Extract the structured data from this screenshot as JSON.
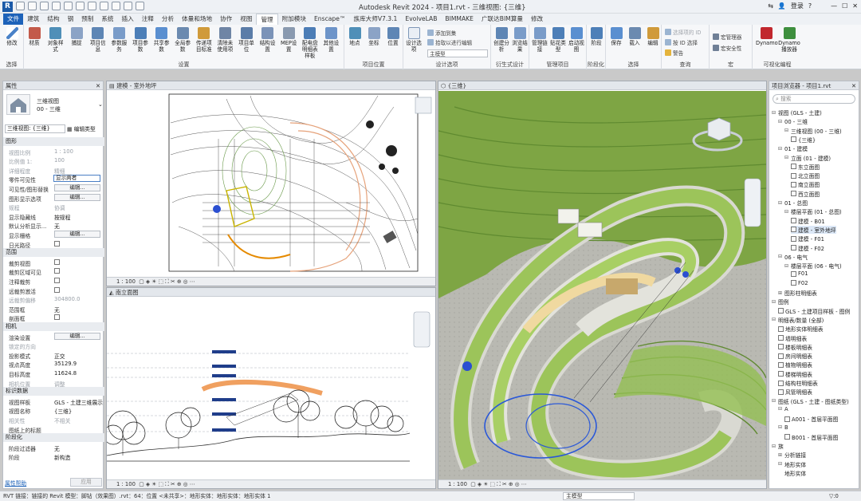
{
  "window": {
    "title": "Autodesk Revit 2024 - 项目1.rvt - 三维视图: {三维}",
    "user": "登录",
    "logo": "R"
  },
  "menu_tabs": [
    {
      "label": "文件",
      "type": "file"
    },
    {
      "label": "建筑"
    },
    {
      "label": "结构"
    },
    {
      "label": "钢"
    },
    {
      "label": "预制"
    },
    {
      "label": "系统"
    },
    {
      "label": "插入"
    },
    {
      "label": "注释"
    },
    {
      "label": "分析"
    },
    {
      "label": "体量和场地"
    },
    {
      "label": "协作"
    },
    {
      "label": "视图"
    },
    {
      "label": "管理",
      "type": "active"
    },
    {
      "label": "附加模块"
    },
    {
      "label": "Enscape™"
    },
    {
      "label": "族库大师V7.3.1"
    },
    {
      "label": "EvolveLAB"
    },
    {
      "label": "BIMMAKE"
    },
    {
      "label": "广联达BIM算量"
    },
    {
      "label": "修改"
    }
  ],
  "ribbon": {
    "groups": [
      {
        "label": "选择",
        "buttons": [
          {
            "label": "修改",
            "icon": "cursor-icon"
          }
        ]
      },
      {
        "label": "设置",
        "buttons": [
          {
            "label": "材质",
            "icon": "material-sphere-icon"
          },
          {
            "label": "对象样式",
            "icon": "object-styles-icon"
          },
          {
            "label": "捕捉",
            "icon": "snap-magnet-icon"
          },
          {
            "label": "项目信息",
            "icon": "project-info-icon"
          },
          {
            "label": "参数服务",
            "icon": "param-service-icon"
          },
          {
            "label": "项目参数",
            "icon": "project-param-icon"
          },
          {
            "label": "共享参数",
            "icon": "shared-param-icon"
          },
          {
            "label": "全局参数",
            "icon": "global-param-icon"
          },
          {
            "label": "传递项目标准",
            "icon": "transfer-standards-icon"
          },
          {
            "label": "清除未使用项",
            "icon": "purge-icon"
          },
          {
            "label": "项目单位",
            "icon": "units-icon"
          },
          {
            "label": "结构设置",
            "icon": "structural-settings-icon"
          },
          {
            "label": "MEP设置",
            "icon": "mep-settings-icon"
          },
          {
            "label": "配电盘明细表样板",
            "icon": "panel-schedule-icon"
          },
          {
            "label": "其他设置",
            "icon": "wrench-icon"
          }
        ]
      },
      {
        "label": "项目位置",
        "buttons": [
          {
            "label": "地点",
            "icon": "globe-icon"
          },
          {
            "label": "坐标",
            "icon": "coordinates-icon"
          },
          {
            "label": "位置",
            "icon": "location-icon"
          }
        ]
      },
      {
        "label": "设计选项",
        "buttons": [
          {
            "label": "设计选项",
            "icon": "design-options-icon"
          }
        ],
        "small": [
          "添加到集",
          "拾取以进行编辑"
        ],
        "select_value": "主模型"
      },
      {
        "label": "衍生式设计",
        "buttons": [
          {
            "label": "创建分析",
            "icon": "create-study-icon"
          },
          {
            "label": "浏览结果",
            "icon": "explore-outcomes-icon"
          }
        ]
      },
      {
        "label": "管理项目",
        "buttons": [
          {
            "label": "管理链接",
            "icon": "manage-links-icon"
          },
          {
            "label": "贴花类型",
            "icon": "decal-icon"
          },
          {
            "label": "启动视图",
            "icon": "startup-view-icon"
          }
        ]
      },
      {
        "label": "阶段化",
        "buttons": [
          {
            "label": "阶段",
            "icon": "phases-icon"
          }
        ]
      },
      {
        "label": "选择",
        "buttons": [
          {
            "label": "保存",
            "icon": "save-selection-icon"
          },
          {
            "label": "载入",
            "icon": "load-selection-icon"
          },
          {
            "label": "编辑",
            "icon": "edit-selection-icon"
          }
        ]
      },
      {
        "label": "查询",
        "small": [
          "选择项的 ID",
          "按 ID 选择",
          "警告"
        ]
      },
      {
        "label": "宏",
        "small": [
          "宏管理器",
          "宏安全性"
        ]
      },
      {
        "label": "可视化编程",
        "buttons": [
          {
            "label": "Dynamo",
            "icon": "dynamo-icon"
          },
          {
            "label": "Dynamo播放器",
            "icon": "dynamo-player-icon"
          }
        ]
      }
    ]
  },
  "properties": {
    "title": "属性",
    "type_name": "三维视图",
    "type_sub": "00 - 三维",
    "selector": "三维视图: {三维}",
    "edit_type": "编辑类型",
    "help": "属性帮助",
    "apply": "应用",
    "rows": [
      {
        "kind": "sec",
        "label": "图形"
      },
      {
        "k": "视图比例",
        "v": "1 : 100",
        "grey": true
      },
      {
        "k": "比例值 1:",
        "v": "100",
        "grey": true
      },
      {
        "k": "详细程度",
        "v": "精细",
        "grey": true
      },
      {
        "k": "零件可见性",
        "v": "显示两者",
        "field": true
      },
      {
        "k": "可见性/图形替换",
        "v": "编辑...",
        "btn": true
      },
      {
        "k": "图形显示选项",
        "v": "编辑...",
        "btn": true
      },
      {
        "k": "规程",
        "v": "协调",
        "grey": true
      },
      {
        "k": "显示隐藏线",
        "v": "按规程"
      },
      {
        "k": "默认分析显示...",
        "v": "无"
      },
      {
        "k": "显示栅格",
        "v": "编辑...",
        "btn": true
      },
      {
        "k": "日光路径",
        "v": "",
        "chk": true
      },
      {
        "kind": "sec",
        "label": "范围"
      },
      {
        "k": "裁剪视图",
        "v": "",
        "chk": true
      },
      {
        "k": "裁剪区域可见",
        "v": "",
        "chk": true
      },
      {
        "k": "注释裁剪",
        "v": "",
        "chk": true
      },
      {
        "k": "远裁剪激活",
        "v": "",
        "chk": true
      },
      {
        "k": "远裁剪偏移",
        "v": "304800.0",
        "grey": true
      },
      {
        "k": "范围框",
        "v": "无"
      },
      {
        "k": "剖面框",
        "v": "",
        "chk": true
      },
      {
        "kind": "sec",
        "label": "相机"
      },
      {
        "k": "渲染设置",
        "v": "编辑...",
        "btn": true
      },
      {
        "k": "锁定的方向",
        "v": "",
        "grey": true
      },
      {
        "k": "投影模式",
        "v": "正交"
      },
      {
        "k": "视点高度",
        "v": "35129.9"
      },
      {
        "k": "目标高度",
        "v": "11624.8"
      },
      {
        "k": "相机位置",
        "v": "调整",
        "grey": true
      },
      {
        "kind": "sec",
        "label": "标识数据"
      },
      {
        "k": "视图样板",
        "v": "GLS - 土建三维展示"
      },
      {
        "k": "视图名称",
        "v": "{三维}"
      },
      {
        "k": "相关性",
        "v": "不相关",
        "grey": true
      },
      {
        "k": "图纸上的标题",
        "v": ""
      },
      {
        "kind": "sec",
        "label": "阶段化"
      },
      {
        "k": "阶段过滤器",
        "v": "无"
      },
      {
        "k": "阶段",
        "v": "新构造"
      }
    ]
  },
  "views": {
    "site": {
      "tab": "建模 - 室外地坪",
      "scale": "1 : 100"
    },
    "elev": {
      "tab": "南立面图",
      "scale": "1 : 100"
    },
    "three_d": {
      "tab": "{三维}",
      "scale": "1 : 100"
    }
  },
  "browser": {
    "title": "项目浏览器 - 项目1.rvt",
    "search_placeholder": "搜索",
    "nodes": [
      {
        "label": "视图 (GLS - 土建)",
        "level": 0,
        "tog": "⊟"
      },
      {
        "label": "00 - 三维",
        "level": 1,
        "tog": "⊟"
      },
      {
        "label": "三维视图 (00 - 三维)",
        "level": 2,
        "tog": "⊟"
      },
      {
        "label": "{三维}",
        "level": 3,
        "box": true
      },
      {
        "label": "01 - 建模",
        "level": 1,
        "tog": "⊟"
      },
      {
        "label": "立面 (01 - 建模)",
        "level": 2,
        "tog": "⊟"
      },
      {
        "label": "东立面图",
        "level": 3,
        "box": true
      },
      {
        "label": "北立面图",
        "level": 3,
        "box": true
      },
      {
        "label": "南立面图",
        "level": 3,
        "box": true
      },
      {
        "label": "西立面图",
        "level": 3,
        "box": true
      },
      {
        "label": "01 - 总图",
        "level": 1,
        "tog": "⊟"
      },
      {
        "label": "楼层平面 (01 - 总图)",
        "level": 2,
        "tog": "⊟"
      },
      {
        "label": "建模 - B01",
        "level": 3,
        "box": true
      },
      {
        "label": "建模 - 室外地坪",
        "level": 3,
        "box": true,
        "sel": true
      },
      {
        "label": "建模 - F01",
        "level": 3,
        "box": true
      },
      {
        "label": "建模 - F02",
        "level": 3,
        "box": true
      },
      {
        "label": "06 - 电气",
        "level": 1,
        "tog": "⊟"
      },
      {
        "label": "楼层平面 (06 - 电气)",
        "level": 2,
        "tog": "⊟"
      },
      {
        "label": "F01",
        "level": 3,
        "box": true
      },
      {
        "label": "F02",
        "level": 3,
        "box": true
      },
      {
        "label": "图形柱明细表",
        "level": 1,
        "tog": "⊞"
      },
      {
        "label": "图例",
        "level": 0,
        "tog": "⊟"
      },
      {
        "label": "GLS - 土建项目样板 - 图例",
        "level": 1,
        "box": true
      },
      {
        "label": "明细表/数量 (全部)",
        "level": 0,
        "tog": "⊟"
      },
      {
        "label": "地形实体明细表",
        "level": 1,
        "box": true
      },
      {
        "label": "墙明细表",
        "level": 1,
        "box": true
      },
      {
        "label": "楼板明细表",
        "level": 1,
        "box": true
      },
      {
        "label": "房间明细表",
        "level": 1,
        "box": true
      },
      {
        "label": "植物明细表",
        "level": 1,
        "box": true
      },
      {
        "label": "楼梯明细表",
        "level": 1,
        "box": true
      },
      {
        "label": "结构柱明细表",
        "level": 1,
        "box": true
      },
      {
        "label": "风管明细表",
        "level": 1,
        "box": true
      },
      {
        "label": "图纸 (GLS - 土建 - 图纸类型)",
        "level": 0,
        "tog": "⊟"
      },
      {
        "label": "A",
        "level": 1,
        "tog": "⊟"
      },
      {
        "label": "A001 - 首层平面图",
        "level": 2,
        "box": true
      },
      {
        "label": "B",
        "level": 1,
        "tog": "⊟"
      },
      {
        "label": "B001 - 首层平面图",
        "level": 2,
        "box": true
      },
      {
        "label": "族",
        "level": 0,
        "tog": "⊟"
      },
      {
        "label": "分析链接",
        "level": 1,
        "tog": "⊞"
      },
      {
        "label": "地形实体",
        "level": 1,
        "tog": "⊟"
      },
      {
        "label": "地形实体",
        "level": 2
      }
    ]
  },
  "status": {
    "text": "RVT 链接：链接的 Revit 模型：脚钻（效果图）.rvt：64：位置 <未共享>：地形实体：地形实体：地形实体 1",
    "model": "主模型",
    "filter": ":0"
  },
  "colors": {
    "accent": "#1d62b9",
    "terrain": "#9cc45a",
    "ground": "#c2c2bc"
  }
}
